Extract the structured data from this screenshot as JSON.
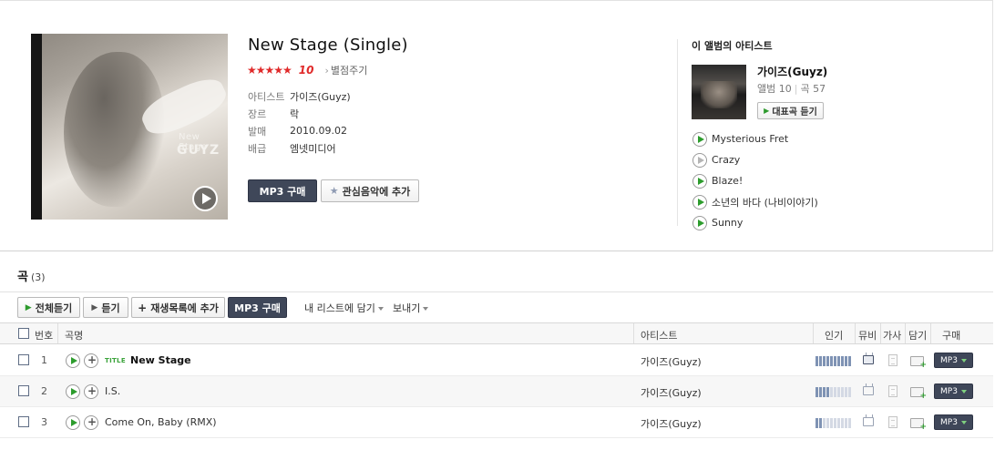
{
  "album": {
    "title": "New Stage (Single)",
    "stars": "★★★★★",
    "score": "10",
    "rate_link": "별점주기",
    "cover_text_small": "New Stage",
    "cover_text_logo": "GUYZ",
    "meta": [
      {
        "label": "아티스트",
        "value": "가이즈(Guyz)"
      },
      {
        "label": "장르",
        "value": "락"
      },
      {
        "label": "발매",
        "value": "2010.09.02"
      },
      {
        "label": "배급",
        "value": "엠넷미디어"
      }
    ],
    "buy_label": "MP3 구매",
    "fav_label": "관심음악에 추가"
  },
  "artist_panel": {
    "heading": "이 앨범의 아티스트",
    "name": "가이즈(Guyz)",
    "albums": "앨범 10",
    "songs": "곡 57",
    "play_label": "대표곡 듣기",
    "songs_list": [
      {
        "title": "Mysterious Fret",
        "enabled": true
      },
      {
        "title": "Crazy",
        "enabled": false
      },
      {
        "title": "Blaze!",
        "enabled": true
      },
      {
        "title": "소년의 바다 (나비이야기)",
        "enabled": true
      },
      {
        "title": "Sunny",
        "enabled": true
      }
    ]
  },
  "tracks_section": {
    "heading": "곡",
    "count": "(3)",
    "toolbar": {
      "play_all": "전체듣기",
      "play": "듣기",
      "add_playlist": "재생목록에 추가",
      "buy": "MP3 구매",
      "my_list": "내 리스트에 담기",
      "share": "보내기"
    },
    "columns": {
      "num": "번호",
      "title": "곡명",
      "artist": "아티스트",
      "popularity": "인기",
      "mv": "뮤비",
      "lyrics": "가사",
      "save": "담기",
      "buy": "구매"
    },
    "title_badge": "TITLE",
    "buy_row_label": "MP3",
    "rows": [
      {
        "num": "1",
        "title": "New Stage",
        "artist": "가이즈(Guyz)",
        "is_title": true,
        "popularity": 10,
        "mv": true
      },
      {
        "num": "2",
        "title": "I.S.",
        "artist": "가이즈(Guyz)",
        "is_title": false,
        "popularity": 4,
        "mv": false
      },
      {
        "num": "3",
        "title": "Come On, Baby (RMX)",
        "artist": "가이즈(Guyz)",
        "is_title": false,
        "popularity": 2,
        "mv": false
      }
    ]
  },
  "colors": {
    "accent_green": "#2d9c2d",
    "star_red": "#e02a2a",
    "button_dark": "#3f4759"
  }
}
